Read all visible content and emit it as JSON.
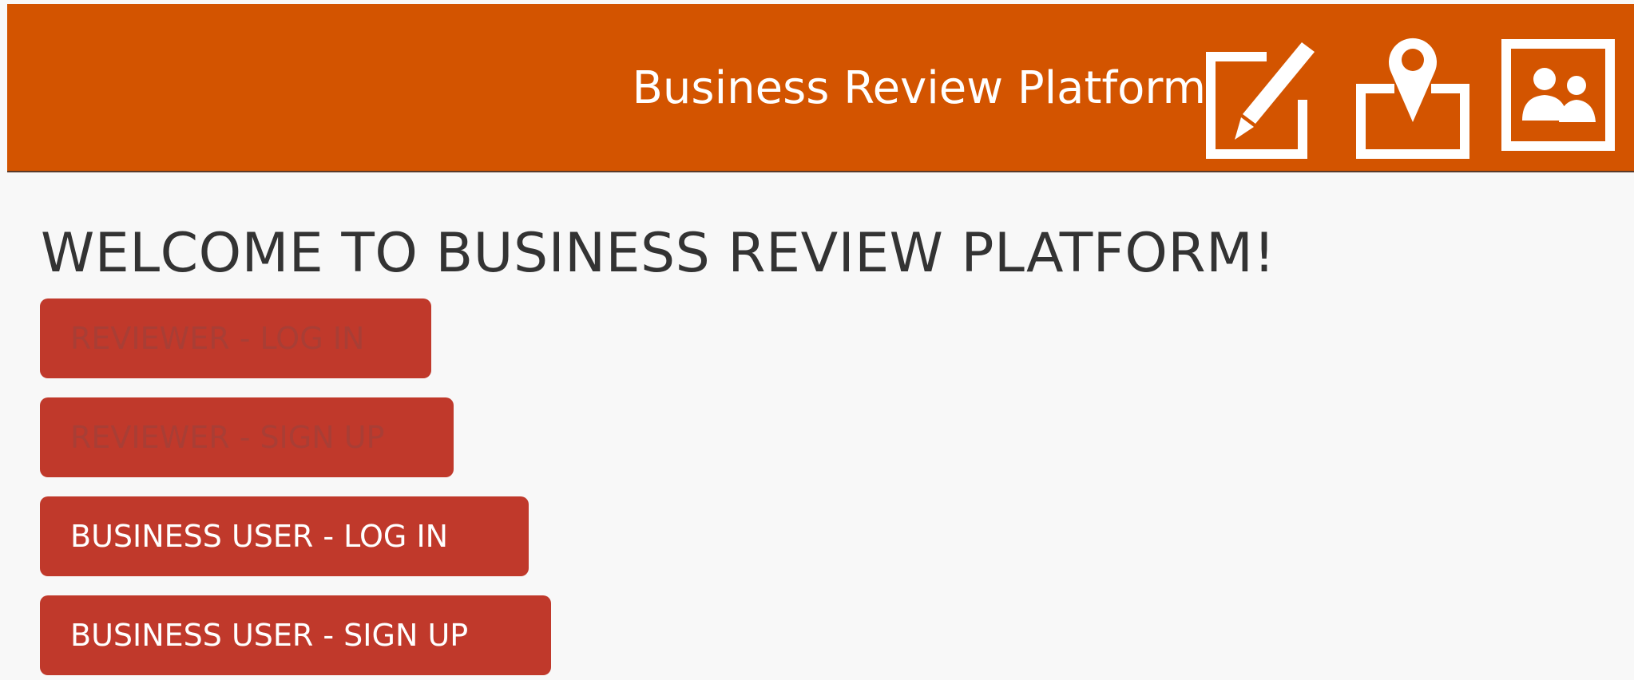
{
  "header": {
    "title": "Business Review Platform",
    "background_color": "#d35400",
    "icons": [
      {
        "name": "edit-icon"
      },
      {
        "name": "location-icon"
      },
      {
        "name": "users-icon"
      }
    ]
  },
  "main": {
    "welcome_text": "WELCOME TO BUSINESS REVIEW PLATFORM!",
    "buttons": [
      {
        "label": "REVIEWER - LOG IN",
        "state": "disabled"
      },
      {
        "label": "REVIEWER - SIGN UP",
        "state": "disabled"
      },
      {
        "label": "BUSINESS USER - LOG IN",
        "state": "enabled"
      },
      {
        "label": "BUSINESS USER - SIGN UP",
        "state": "enabled"
      }
    ],
    "button_color": "#c0392b"
  }
}
